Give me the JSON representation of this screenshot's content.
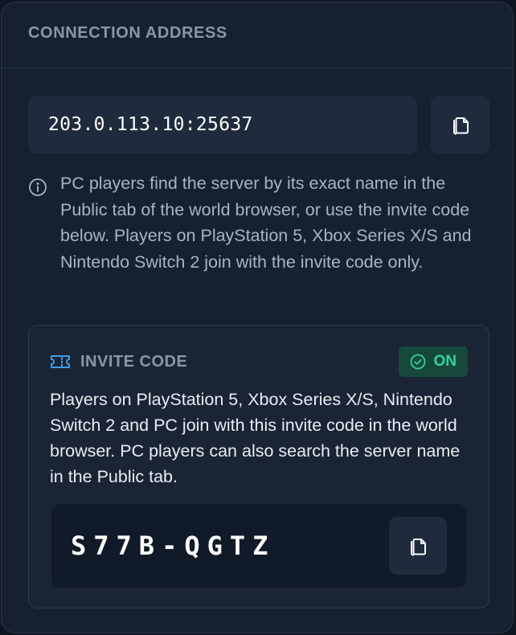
{
  "panel": {
    "title": "CONNECTION ADDRESS"
  },
  "address": {
    "value": "203.0.113.10:25637",
    "copy_icon": "copy-icon"
  },
  "info": {
    "icon": "info-icon",
    "text": "PC players find the server by its exact name in the Public tab of the world browser, or use the invite code below. Players on PlayStation 5, Xbox Series X/S and Nintendo Switch 2 join with the invite code only."
  },
  "invite": {
    "icon": "ticket-icon",
    "title": "INVITE CODE",
    "status": {
      "icon": "check-circle-icon",
      "label": "ON"
    },
    "description": "Players on PlayStation 5, Xbox Series X/S, Nintendo Switch 2 and PC join with this invite code in the world browser. PC players can also search the server name in the Public tab.",
    "code": "S77B-QGTZ",
    "copy_icon": "copy-icon"
  },
  "colors": {
    "background": "#0f1623",
    "panel": "#162030",
    "field": "#1f2a3c",
    "accent_blue": "#3b9eea",
    "status_green": "#34d399",
    "status_bg": "#16483d"
  }
}
